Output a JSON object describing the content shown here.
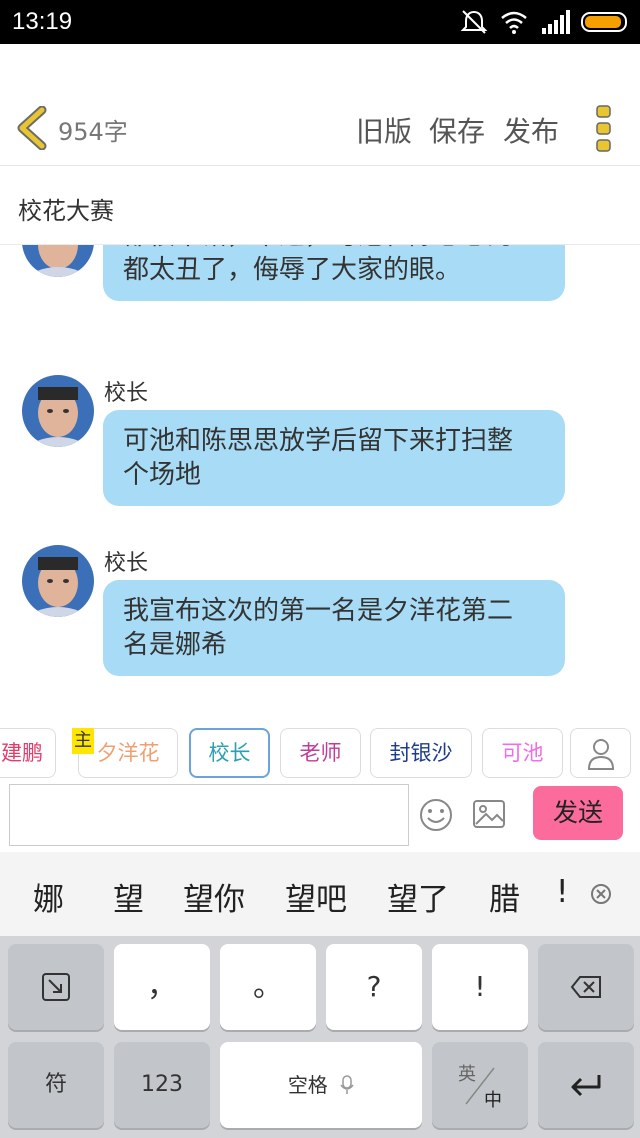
{
  "status_bar": {
    "time": "13:19"
  },
  "header": {
    "word_count": "954字",
    "old_version": "旧版",
    "save": "保存",
    "publish": "发布"
  },
  "story_title": "校花大赛",
  "messages": [
    {
      "sender": "",
      "text_lines": [
        "都很不错，不过，可池和陈思思的",
        "都太丑了，侮辱了大家的眼。"
      ]
    },
    {
      "sender": "校长",
      "text_lines": [
        "可池和陈思思放学后留下来打扫整",
        "个场地"
      ]
    },
    {
      "sender": "校长",
      "text_lines": [
        "我宣布这次的第一名是夕洋花第二",
        "名是娜希"
      ]
    }
  ],
  "characters": {
    "main_tag": "主",
    "items": [
      {
        "label": "建鹏",
        "color": "#e23c6a"
      },
      {
        "label": "夕洋花",
        "color": "#f0a070"
      },
      {
        "label": "校长",
        "color": "#2d9fb0"
      },
      {
        "label": "老师",
        "color": "#c03c9a"
      },
      {
        "label": "封银沙",
        "color": "#1e3c8c"
      },
      {
        "label": "可池",
        "color": "#ee6ee6"
      }
    ]
  },
  "composer": {
    "input_value": "",
    "send_label": "发送"
  },
  "candidates": [
    "娜",
    "望",
    "望你",
    "望吧",
    "望了",
    "腊",
    "!"
  ],
  "keyboard": {
    "row1": [
      "，",
      "。",
      "?",
      "!"
    ],
    "symbols": "符",
    "numbers": "123",
    "space": "空格",
    "lang_top": "英",
    "lang_bottom": "中"
  },
  "colors": {
    "bubble": "#a8dcf6",
    "send_button": "#fb6b9c",
    "back_chevron": "#e9c531",
    "menu_dots": "#e9c531"
  }
}
